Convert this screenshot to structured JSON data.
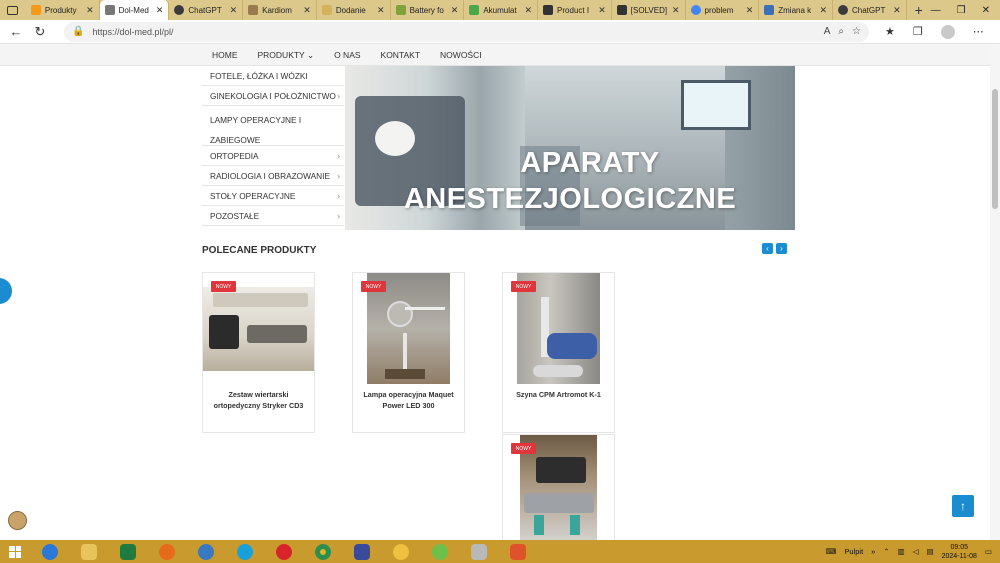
{
  "browser": {
    "tabs": [
      {
        "title": "Produkty",
        "color": "#f39a1e",
        "active": false
      },
      {
        "title": "Dol-Med",
        "color": "#777777",
        "active": true
      },
      {
        "title": "ChatGPT",
        "color": "#3b3b3b",
        "active": false
      },
      {
        "title": "Kardiom",
        "color": "#9a7b4f",
        "active": false
      },
      {
        "title": "Dodanie",
        "color": "#d4b25a",
        "active": false
      },
      {
        "title": "Battery fo",
        "color": "#7fa33a",
        "active": false
      },
      {
        "title": "Akumulat",
        "color": "#4aa84a",
        "active": false
      },
      {
        "title": "Product I",
        "color": "#333333",
        "active": false
      },
      {
        "title": "[SOLVED]",
        "color": "#333333",
        "active": false
      },
      {
        "title": "problem",
        "color": "#4285f4",
        "active": false
      },
      {
        "title": "Zmiana k",
        "color": "#3b6fb6",
        "active": false
      },
      {
        "title": "ChatGPT",
        "color": "#3b3b3b",
        "active": false
      }
    ],
    "url": "https://dol-med.pl/pl/"
  },
  "nav": {
    "items": [
      "HOME",
      "PRODUKTY",
      "O NAS",
      "KONTAKT",
      "NOWOŚCI"
    ]
  },
  "categories": [
    {
      "label": "FOTELE, ŁÓŻKA I WÓZKI",
      "arrow": false
    },
    {
      "label": "GINEKOLOGIA I POŁOŻNICTWO",
      "arrow": true
    },
    {
      "label": "LAMPY OPERACYJNE I ZABIEGOWE",
      "line1": "LAMPY OPERACYJNE I",
      "line2": "ZABIEGOWE",
      "arrow": false
    },
    {
      "label": "ORTOPEDIA",
      "arrow": true
    },
    {
      "label": "RADIOLOGIA I OBRAZOWANIE",
      "arrow": true
    },
    {
      "label": "STOŁY OPERACYJNE",
      "arrow": true
    },
    {
      "label": "POZOSTAŁE",
      "arrow": true
    }
  ],
  "hero": {
    "line1": "APARATY",
    "line2": "ANESTEZJOLOGICZNE"
  },
  "section": {
    "title": "POLECANE PRODUKTY"
  },
  "products": [
    {
      "name": "Zestaw wiertarski ortopedyczny Stryker CD3",
      "badge": "NOWY"
    },
    {
      "name": "Lampa operacyjna Maquet Power LED 300",
      "badge": "NOWY"
    },
    {
      "name": "Szyna CPM Artromot K-1",
      "badge": "NOWY"
    },
    {
      "name": "",
      "badge": "NOWY"
    }
  ],
  "taskbar": {
    "tray_label": "Pulpit",
    "time": "09:05",
    "date": "2024-11-08"
  },
  "colors": {
    "accent": "#1a8ccf",
    "badge": "#e0353b",
    "tabstrip": "#dcc88b",
    "taskbar": "#c99a2e"
  }
}
